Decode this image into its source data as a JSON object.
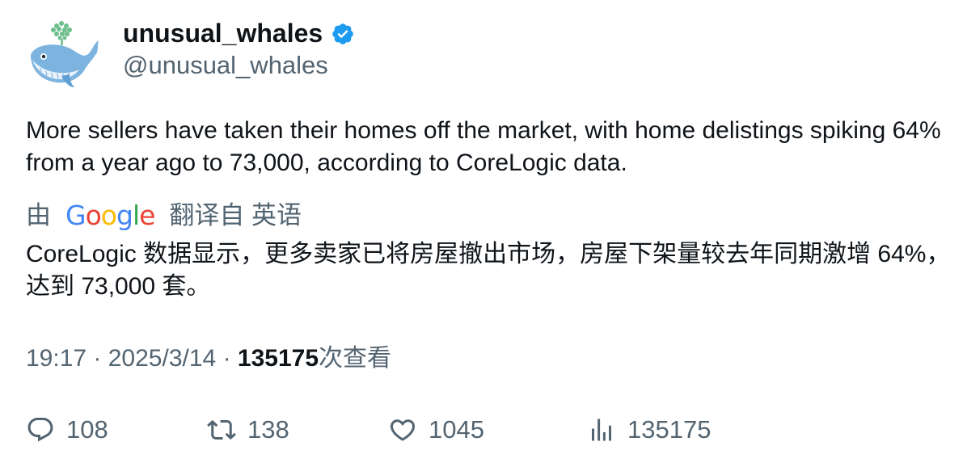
{
  "author": {
    "display_name": "unusual_whales",
    "handle": "@unusual_whales",
    "verified": true,
    "avatar_icon": "whale-avatar-icon",
    "verified_icon": "verified-badge-icon",
    "verified_color": "#1d9bf0"
  },
  "tweet": {
    "text": "More sellers have taken their homes off the market, with home delistings spiking 64% from a year ago to 73,000, according to CoreLogic data."
  },
  "translation": {
    "prefix": "由",
    "provider": "Google",
    "suffix": "翻译自 英语",
    "text": "CoreLogic 数据显示，更多卖家已将房屋撤出市场，房屋下架量较去年同期激增 64%，达到 73,000 套。"
  },
  "meta": {
    "time": "19:17",
    "separator": "·",
    "date": "2025/3/14",
    "views_count": "135175",
    "views_label": "次查看"
  },
  "actions": {
    "replies": "108",
    "retweets": "138",
    "likes": "1045",
    "views": "135175"
  },
  "colors": {
    "text_primary": "#0f1419",
    "text_secondary": "#536471",
    "google_blue": "#4285F4",
    "google_red": "#EA4335",
    "google_yellow": "#FBBC05",
    "google_green": "#34A853"
  }
}
